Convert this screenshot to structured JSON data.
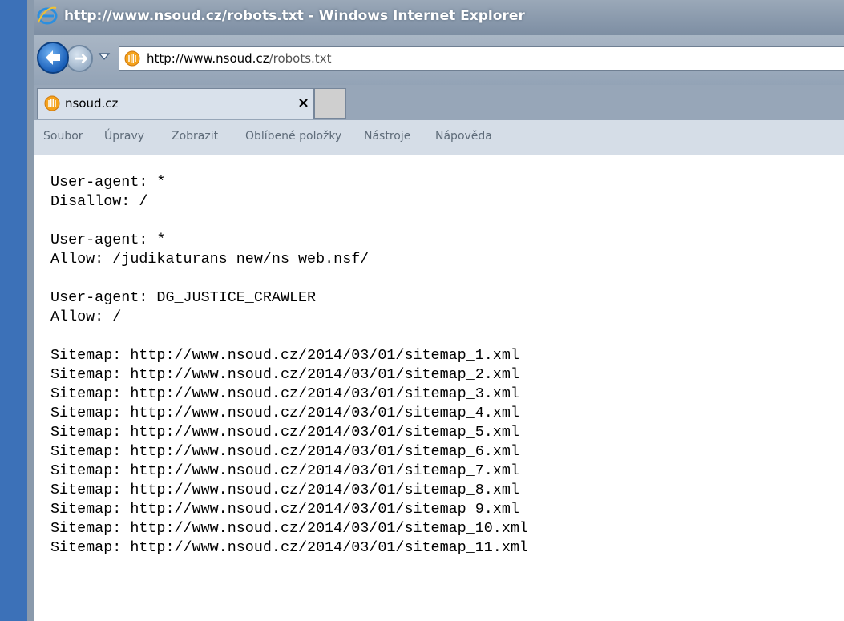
{
  "window": {
    "title": "http://www.nsoud.cz/robots.txt - Windows Internet Explorer",
    "accent": "#3c71b8"
  },
  "address_bar": {
    "host": "http://www.nsoud.cz",
    "path": "/robots.txt"
  },
  "tab": {
    "label": "nsoud.cz",
    "close_glyph": "×"
  },
  "menu": {
    "items": [
      "Soubor",
      "Úpravy",
      "Zobrazit",
      "Oblíbené položky",
      "Nástroje",
      "Nápověda"
    ]
  },
  "icons": {
    "title": "ie-logo-icon",
    "back": "back-arrow-icon",
    "forward": "forward-arrow-icon",
    "recent": "chevron-down-icon",
    "favicon": "site-favicon-icon"
  },
  "content": {
    "lines": [
      "User-agent: *",
      "Disallow: /",
      "",
      "User-agent: *",
      "Allow: /judikaturans_new/ns_web.nsf/",
      "",
      "User-agent: DG_JUSTICE_CRAWLER",
      "Allow: /",
      "",
      "Sitemap: http://www.nsoud.cz/2014/03/01/sitemap_1.xml",
      "Sitemap: http://www.nsoud.cz/2014/03/01/sitemap_2.xml",
      "Sitemap: http://www.nsoud.cz/2014/03/01/sitemap_3.xml",
      "Sitemap: http://www.nsoud.cz/2014/03/01/sitemap_4.xml",
      "Sitemap: http://www.nsoud.cz/2014/03/01/sitemap_5.xml",
      "Sitemap: http://www.nsoud.cz/2014/03/01/sitemap_6.xml",
      "Sitemap: http://www.nsoud.cz/2014/03/01/sitemap_7.xml",
      "Sitemap: http://www.nsoud.cz/2014/03/01/sitemap_8.xml",
      "Sitemap: http://www.nsoud.cz/2014/03/01/sitemap_9.xml",
      "Sitemap: http://www.nsoud.cz/2014/03/01/sitemap_10.xml",
      "Sitemap: http://www.nsoud.cz/2014/03/01/sitemap_11.xml"
    ]
  }
}
